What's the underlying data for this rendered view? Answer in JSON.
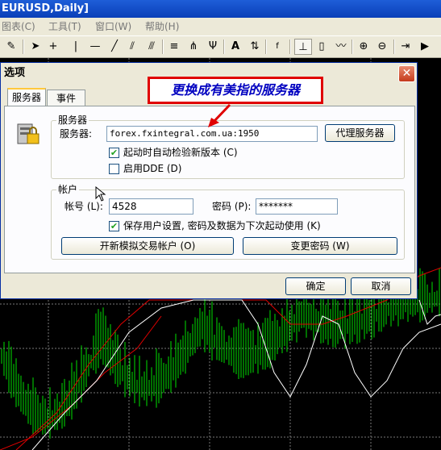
{
  "window": {
    "title": "EURUSD,Daily]"
  },
  "menu": [
    {
      "label": "图表(C)"
    },
    {
      "label": "工具(T)"
    },
    {
      "label": "窗口(W)"
    },
    {
      "label": "帮助(H)"
    }
  ],
  "toolbar_icons": [
    "pencil-icon",
    "crosshair-icon",
    "vertical-line-icon",
    "horizontal-line-icon",
    "trendline-icon",
    "channel-icon",
    "fibo-icon",
    "grid-fibo-icon",
    "gann-icon",
    "text-icon",
    "arrows-icon",
    "period-icon",
    "bar-chart-icon",
    "candle-chart-icon",
    "line-chart-icon",
    "zoom-in-icon",
    "zoom-out-icon",
    "chart-shift-icon",
    "autoscroll-icon"
  ],
  "dialog": {
    "title": "选项",
    "close_symbol": "✕",
    "tabs": [
      {
        "label": "服务器"
      },
      {
        "label": "事件"
      }
    ],
    "server_group": {
      "label": "服务器",
      "server_label": "服务器:",
      "server_value": "forex.fxintegral.com.ua:1950",
      "proxy_button": "代理服务器",
      "check_auto_update": {
        "label": "起动时自动检验新版本 (C)",
        "checked": true
      },
      "check_dde": {
        "label": "启用DDE (D)",
        "checked": false
      }
    },
    "account_group": {
      "label": "帐户",
      "login_label": "帐号 (L):",
      "login_value": "4528",
      "password_label": "密码 (P):",
      "password_value": "*******",
      "check_save": {
        "label": "保存用户设置, 密码及数据为下次起动使用 (K)",
        "checked": true
      },
      "open_demo_button": "开新模拟交易帐户 (O)",
      "change_password_button": "变更密码 (W)"
    },
    "ok_button": "确定",
    "cancel_button": "取消"
  },
  "annotation": {
    "text": "更换成有美指的服务器",
    "color": "#e00000"
  }
}
